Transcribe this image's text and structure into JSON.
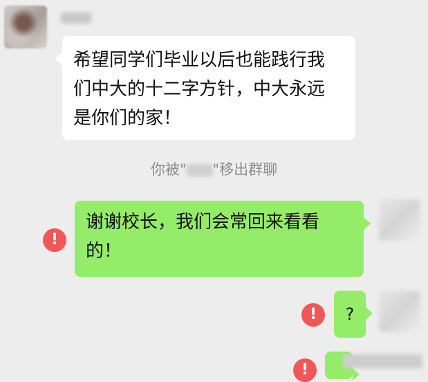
{
  "chat": {
    "incoming_message": {
      "lines": [
        "希望同学们毕业以后也能践行我",
        "们中大的十二字方针，中大永远",
        "是你们的家！"
      ]
    },
    "system_notice": {
      "prefix": "你被\"",
      "suffix": "\"移出群聊"
    },
    "outgoing_messages": [
      {
        "lines": [
          "谢谢校长，我们会常回来看看",
          "的！"
        ],
        "status": "failed"
      },
      {
        "text": "?",
        "status": "failed"
      },
      {
        "text": "",
        "status": "failed"
      }
    ],
    "error_icon_glyph": "!"
  },
  "colors": {
    "background": "#ededed",
    "incoming_bubble": "#ffffff",
    "outgoing_bubble": "#95ec69",
    "error_icon": "#f25757",
    "system_text": "#8c8c8c"
  }
}
